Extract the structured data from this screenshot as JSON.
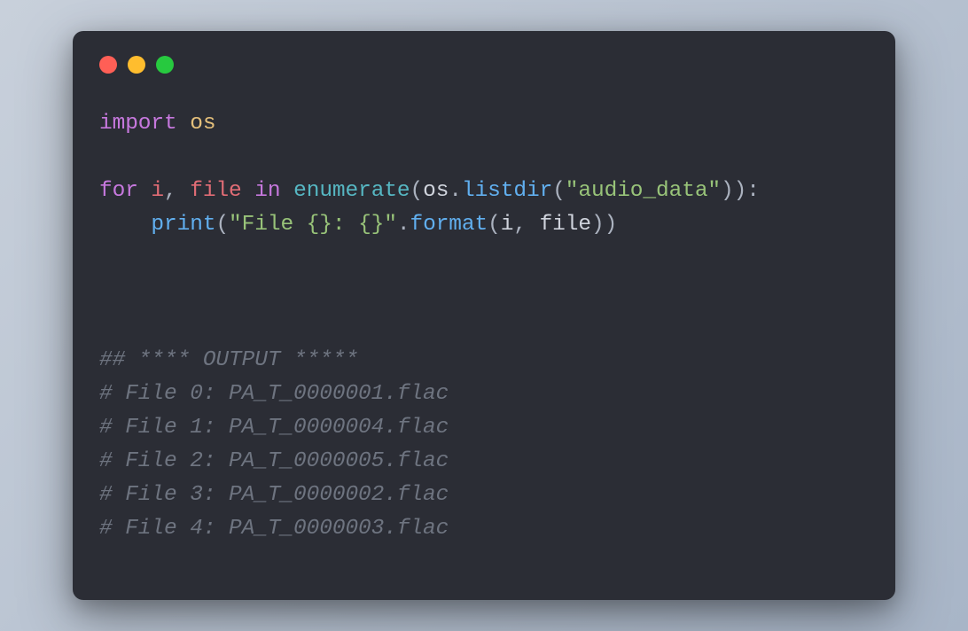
{
  "code": {
    "line1": {
      "import_kw": "import",
      "module": "os"
    },
    "line2": {
      "for_kw": "for",
      "var_i": "i",
      "comma1": ", ",
      "var_file": "file",
      "in_kw": "in",
      "enumerate_fn": "enumerate",
      "open_paren": "(",
      "os_ref": "os",
      "dot1": ".",
      "listdir_fn": "listdir",
      "open_paren2": "(",
      "str_arg": "\"audio_data\"",
      "close1": ")):"
    },
    "line3": {
      "indent": "    ",
      "print_fn": "print",
      "open_paren": "(",
      "fmt_str": "\"File {}: {}\"",
      "dot": ".",
      "format_fn": "format",
      "open_paren2": "(",
      "arg_i": "i",
      "comma": ", ",
      "arg_file": "file",
      "close": "))"
    }
  },
  "output": {
    "header": "## **** OUTPUT *****",
    "lines": [
      "# File 0: PA_T_0000001.flac",
      "# File 1: PA_T_0000004.flac",
      "# File 2: PA_T_0000005.flac",
      "# File 3: PA_T_0000002.flac",
      "# File 4: PA_T_0000003.flac"
    ]
  }
}
